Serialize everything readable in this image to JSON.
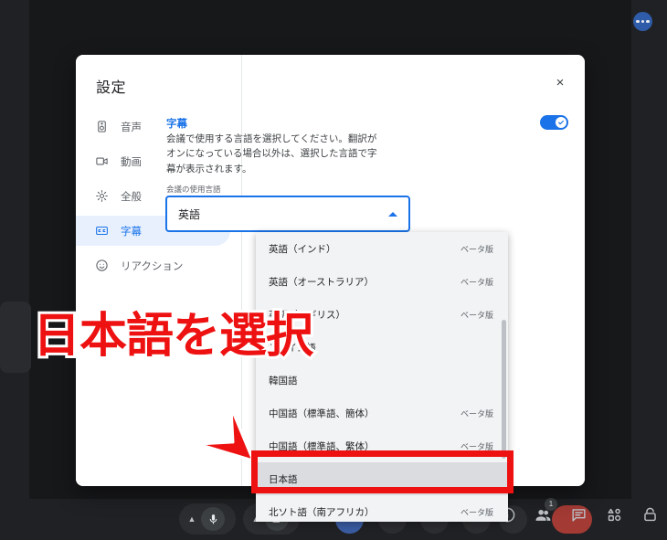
{
  "app": {
    "background_color": "#202124",
    "fab_more_label": "more-options"
  },
  "dialog": {
    "title": "設定",
    "close_label": "×",
    "sidebar": {
      "items": [
        {
          "label": "音声",
          "icon": "speaker-icon",
          "active": false
        },
        {
          "label": "動画",
          "icon": "video-camera-icon",
          "active": false
        },
        {
          "label": "全般",
          "icon": "gear-icon",
          "active": false
        },
        {
          "label": "字幕",
          "icon": "closed-caption-icon",
          "active": true
        },
        {
          "label": "リアクション",
          "icon": "smiley-face-icon",
          "active": false
        }
      ]
    },
    "main": {
      "section_title": "字幕",
      "section_title_color": "#1a73e8",
      "description": "会議で使用する言語を選択してください。翻訳がオンになっている場合以外は、選択した言語で字幕が表示されます。",
      "toggle": {
        "name": "captions-toggle",
        "on": true,
        "color": "#1a73e8"
      },
      "field_label": "会議の使用言語",
      "select": {
        "value": "英語",
        "expanded": true,
        "border_color": "#1a73e8"
      }
    }
  },
  "dropdown": {
    "options": [
      {
        "label": "英語（インド）",
        "badge": "ベータ版",
        "selected": false
      },
      {
        "label": "英語（オーストラリア）",
        "badge": "ベータ版",
        "selected": false
      },
      {
        "label": "英語（イギリス）",
        "badge": "ベータ版",
        "selected": false
      },
      {
        "label": "スペイン語",
        "badge": "",
        "selected": false
      },
      {
        "label": "韓国語",
        "badge": "",
        "selected": false
      },
      {
        "label": "中国語（標準語、簡体）",
        "badge": "ベータ版",
        "selected": false
      },
      {
        "label": "中国語（標準語、繁体）",
        "badge": "ベータ版",
        "selected": false
      },
      {
        "label": "日本語",
        "badge": "",
        "selected": true
      },
      {
        "label": "北ソト語（南アフリカ）",
        "badge": "ベータ版",
        "selected": false
      }
    ]
  },
  "annotation": {
    "text": "日本語を選択",
    "color": "#ee1111",
    "arrow": "down-right-arrow",
    "highlight_box": "red-rectangle-around-japanese-option"
  },
  "bottom_bar": {
    "mic_icon": "microphone-icon",
    "camera_icon": "camera-icon",
    "mic_chevron": "chevron-up-icon",
    "camera_chevron": "chevron-up-icon",
    "right_icons": [
      {
        "name": "info-icon",
        "badge": ""
      },
      {
        "name": "people-icon",
        "badge": "1"
      },
      {
        "name": "chat-icon",
        "badge": ""
      },
      {
        "name": "activities-icon",
        "badge": ""
      },
      {
        "name": "host-controls-icon",
        "badge": ""
      }
    ]
  }
}
